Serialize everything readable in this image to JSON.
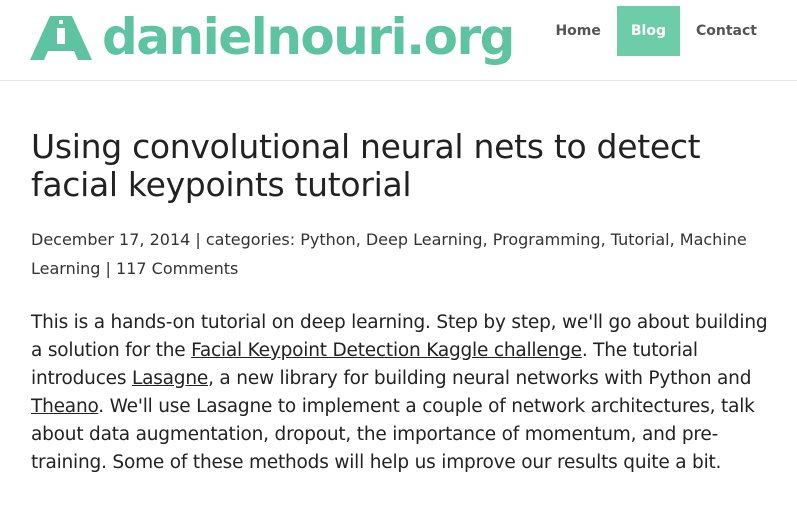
{
  "header": {
    "logo_text": "danielnouri.org",
    "nav": {
      "home": "Home",
      "blog": "Blog",
      "contact": "Contact"
    }
  },
  "post": {
    "title": "Using convolutional neural nets to detect facial keypoints tutorial",
    "date": "December 17, 2014",
    "separator": " | ",
    "categories_label": "categories: ",
    "categories": [
      "Python",
      "Deep Learning",
      "Programming",
      "Tutorial",
      "Machine Learning"
    ],
    "category_separator": ", ",
    "comments": "117 Comments",
    "body": {
      "p1": "This is a hands-on tutorial on deep learning. Step by step, we'll go about building a solution for the ",
      "link1": "Facial Keypoint Detection Kaggle challenge",
      "p2": ". The tutorial introduces ",
      "link2": "Lasagne",
      "p3": ", a new library for building neural networks with Python and ",
      "link3": "Theano",
      "p4": ". We'll use Lasagne to implement a couple of network architectures, talk about data augmentation, dropout, the importance of momentum, and pre-training. Some of these methods will help us improve our results quite a bit."
    }
  },
  "colors": {
    "brand": "#5dc3a1",
    "nav_active_bg": "#6ccda8",
    "text": "#222222"
  },
  "icons": {
    "logo": "logo-a-mark-icon"
  }
}
